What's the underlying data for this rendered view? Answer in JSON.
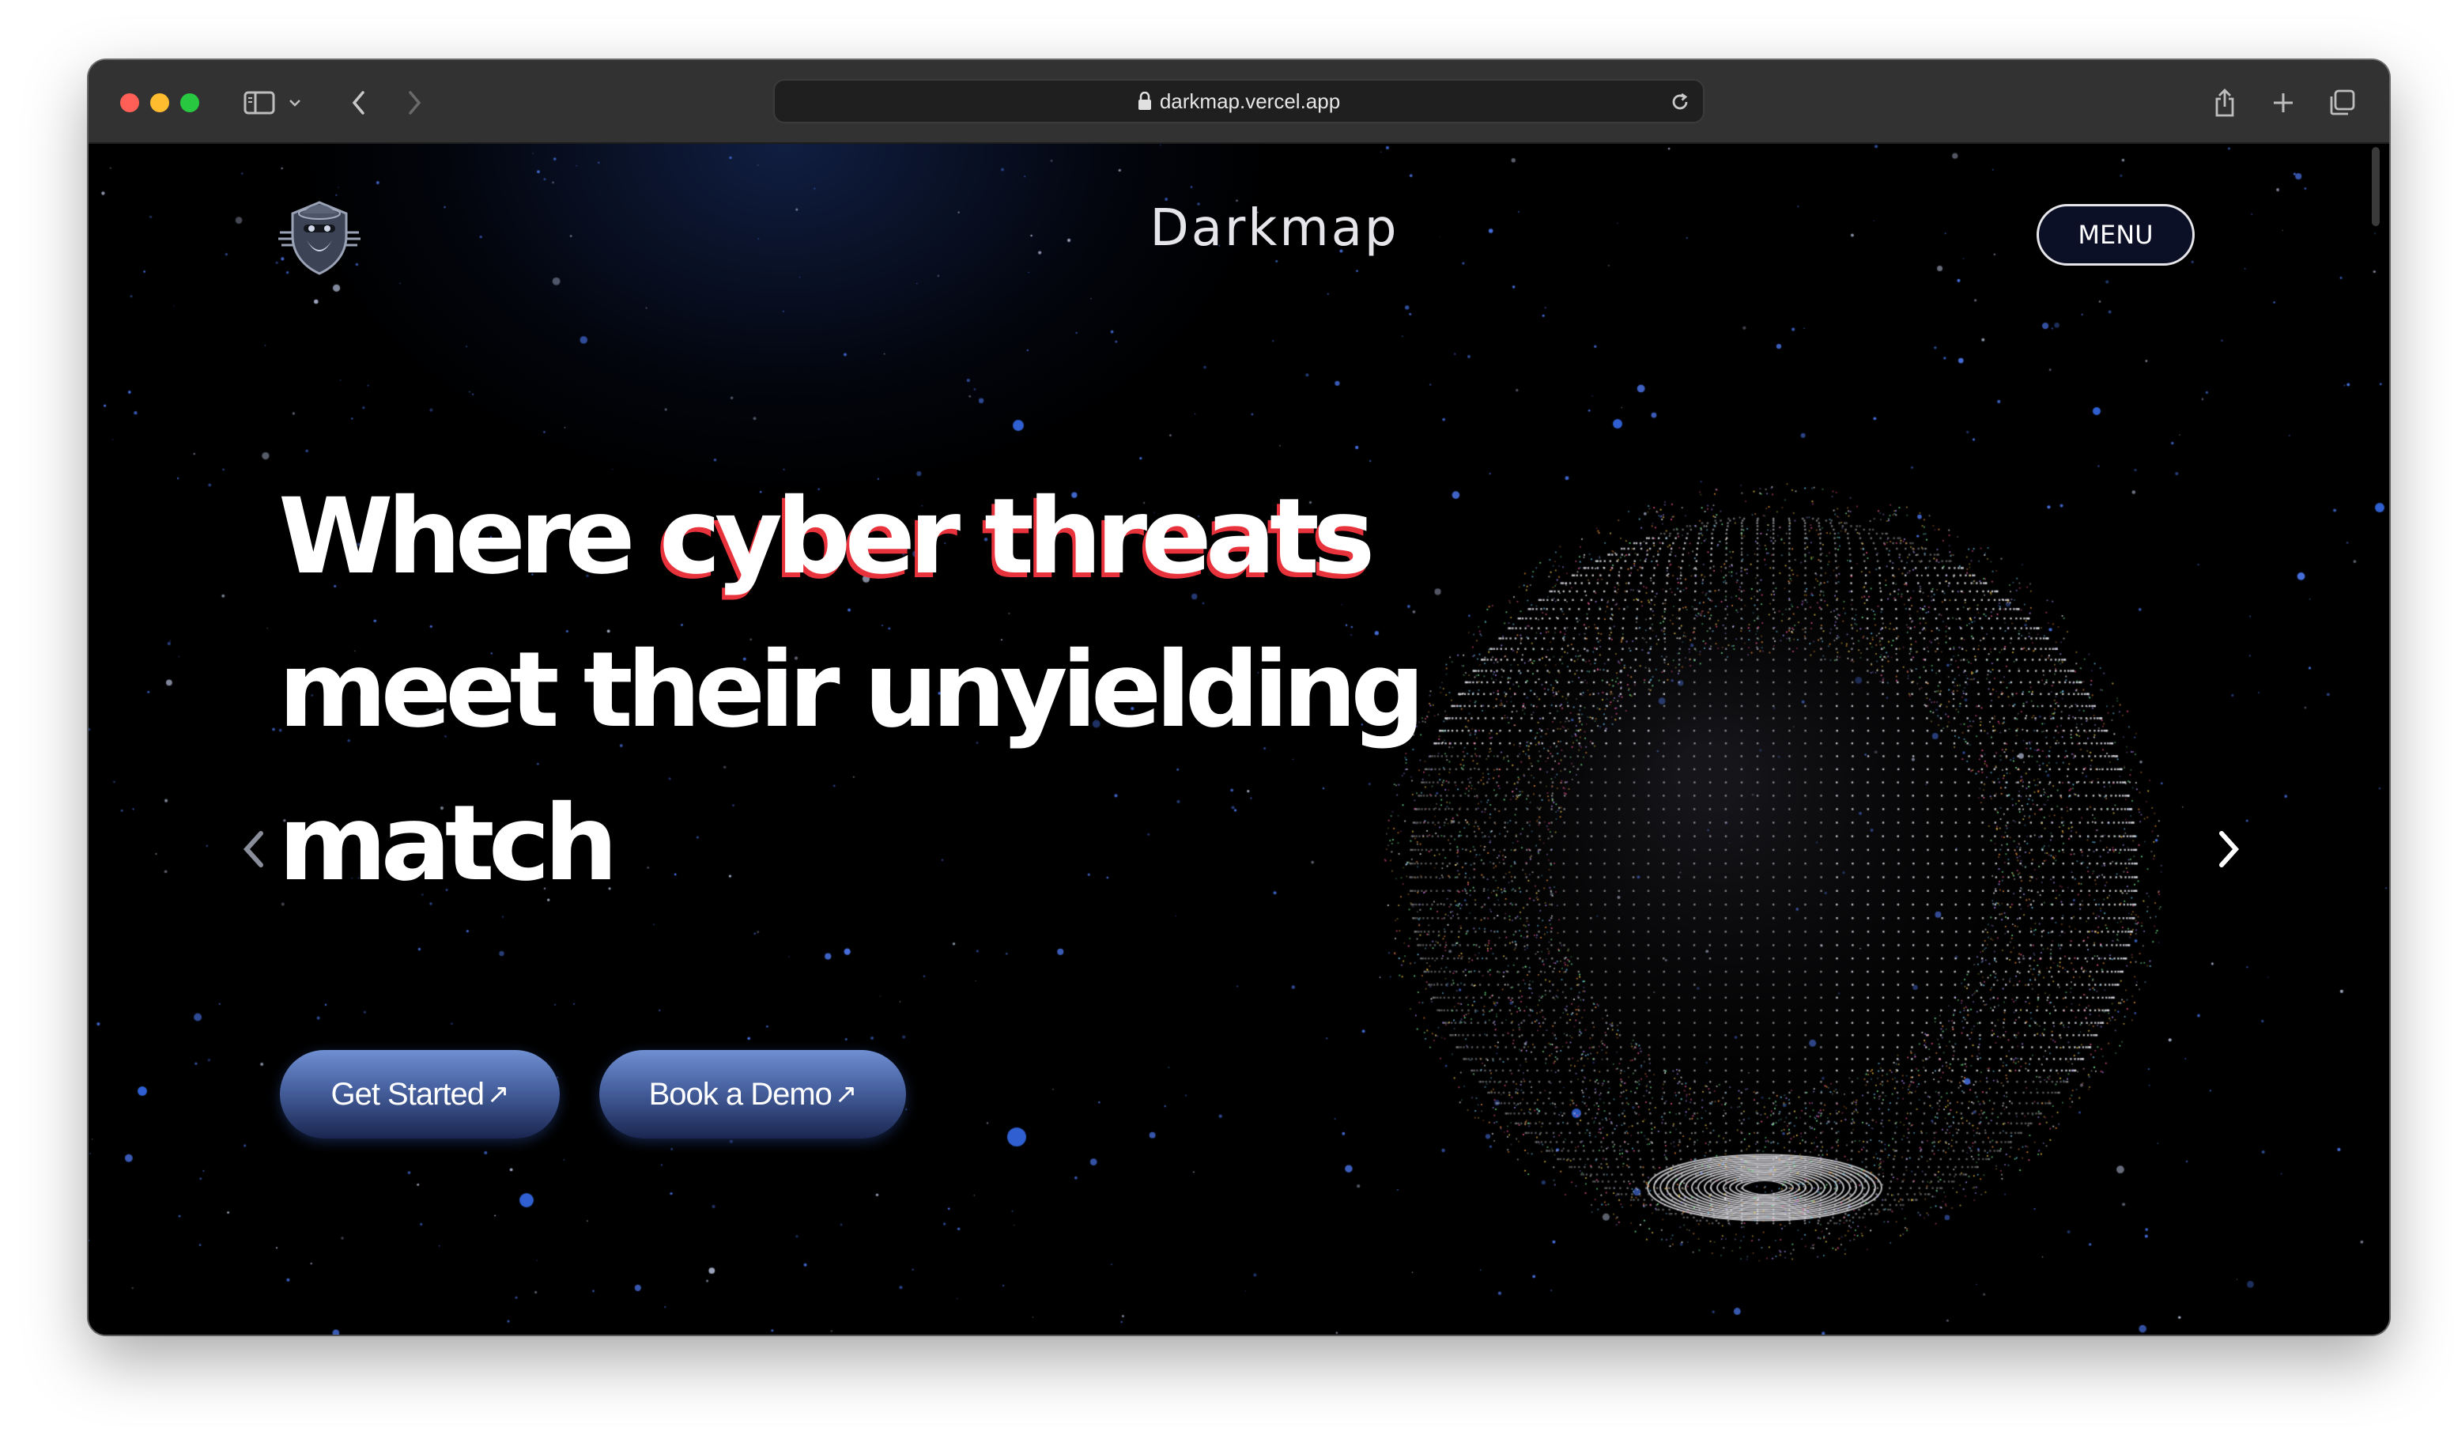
{
  "browser": {
    "url": "darkmap.vercel.app",
    "traffic_lights": {
      "close": "#ff5f57",
      "minimize": "#febc2e",
      "zoom": "#28c840"
    },
    "icons": {
      "sidebar": "sidebar-icon",
      "chevron": "chevron-down-icon",
      "back": "back-arrow-icon",
      "forward": "forward-arrow-icon",
      "lock": "lock-icon",
      "reload": "reload-icon",
      "share": "share-icon",
      "new_tab": "plus-icon",
      "tabs": "tabs-overview-icon"
    }
  },
  "site": {
    "brand": "Darkmap",
    "menu_label": "MENU",
    "logo_icon": "hacker-shield-logo-icon",
    "hero": {
      "line1_a": "Where ",
      "line1_b": "cyber threats",
      "line2": "meet their unyielding",
      "line3": "match"
    },
    "buttons": {
      "get_started": "Get Started",
      "book_demo": "Book a Demo",
      "arrow": "↗"
    },
    "carousel": {
      "slide_count": 2,
      "active_slide": 1,
      "prev_icon": "chevron-left-icon",
      "next_icon": "chevron-right-icon"
    },
    "colors": {
      "background": "#000000",
      "accent_red": "#e8323c",
      "button_blue": "#5b78c0",
      "star_blue": "#2f5fd0"
    },
    "globe_icon": "particle-earth-globe"
  }
}
